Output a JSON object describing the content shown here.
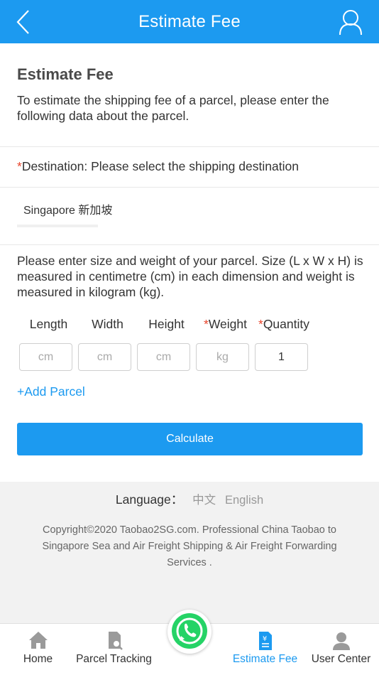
{
  "header": {
    "title": "Estimate Fee"
  },
  "intro": {
    "heading": "Estimate Fee",
    "text": "To estimate the shipping fee of a parcel, please enter the following data about the parcel."
  },
  "destination": {
    "required_mark": "*",
    "label": "Destination: Please select the shipping destination",
    "selected": "Singapore 新加坡"
  },
  "parcel": {
    "note": "Please enter size and weight of your parcel. Size (L x W x H) is measured in centimetre (cm) in each dimension and weight is measured in kilogram (kg).",
    "fields": {
      "length": {
        "label": "Length",
        "placeholder": "cm"
      },
      "width": {
        "label": "Width",
        "placeholder": "cm"
      },
      "height": {
        "label": "Height",
        "placeholder": "cm"
      },
      "weight": {
        "label": "Weight",
        "placeholder": "kg"
      },
      "quantity": {
        "label": "Quantity",
        "value": "1"
      }
    },
    "add_parcel": "+Add Parcel"
  },
  "calculate_label": "Calculate",
  "footer": {
    "language_label": "Language：",
    "lang_zh": "中文",
    "lang_en": "English",
    "copyright": "Copyright©2020 Taobao2SG.com. Professional China Taobao to Singapore Sea and Air Freight Shipping & Air Freight Forwarding Services ."
  },
  "tabs": {
    "home": "Home",
    "tracking": "Parcel Tracking",
    "estimate": "Estimate Fee",
    "user": "User Center"
  },
  "colors": {
    "accent": "#1c9af0",
    "required": "#e8452c",
    "whatsapp": "#25d366"
  }
}
